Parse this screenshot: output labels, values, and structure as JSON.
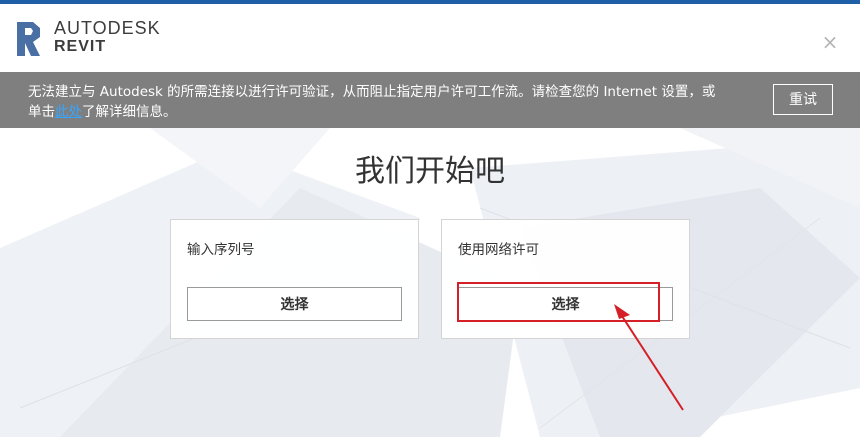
{
  "app": {
    "brand_line1": "AUTODESK",
    "brand_line2": "REVIT",
    "close_symbol": "×"
  },
  "banner": {
    "text_before_link": "无法建立与 Autodesk 的所需连接以进行许可验证，从而阻止指定用户许可工作流。请检查您的 Internet 设置，或单击",
    "link_text": "此处",
    "text_after_link": "了解详细信息。",
    "retry_label": "重试"
  },
  "main": {
    "title": "我们开始吧",
    "cards": [
      {
        "label": "输入序列号",
        "button_label": "选择"
      },
      {
        "label": "使用网络许可",
        "button_label": "选择"
      }
    ]
  },
  "colors": {
    "banner_bg": "#7f7f7f",
    "link": "#37a6ff",
    "annotation": "#d42026",
    "top_accent": "#1f5fa8"
  },
  "icons": {
    "logo": "revit-r-logo-icon",
    "close": "close-icon"
  }
}
